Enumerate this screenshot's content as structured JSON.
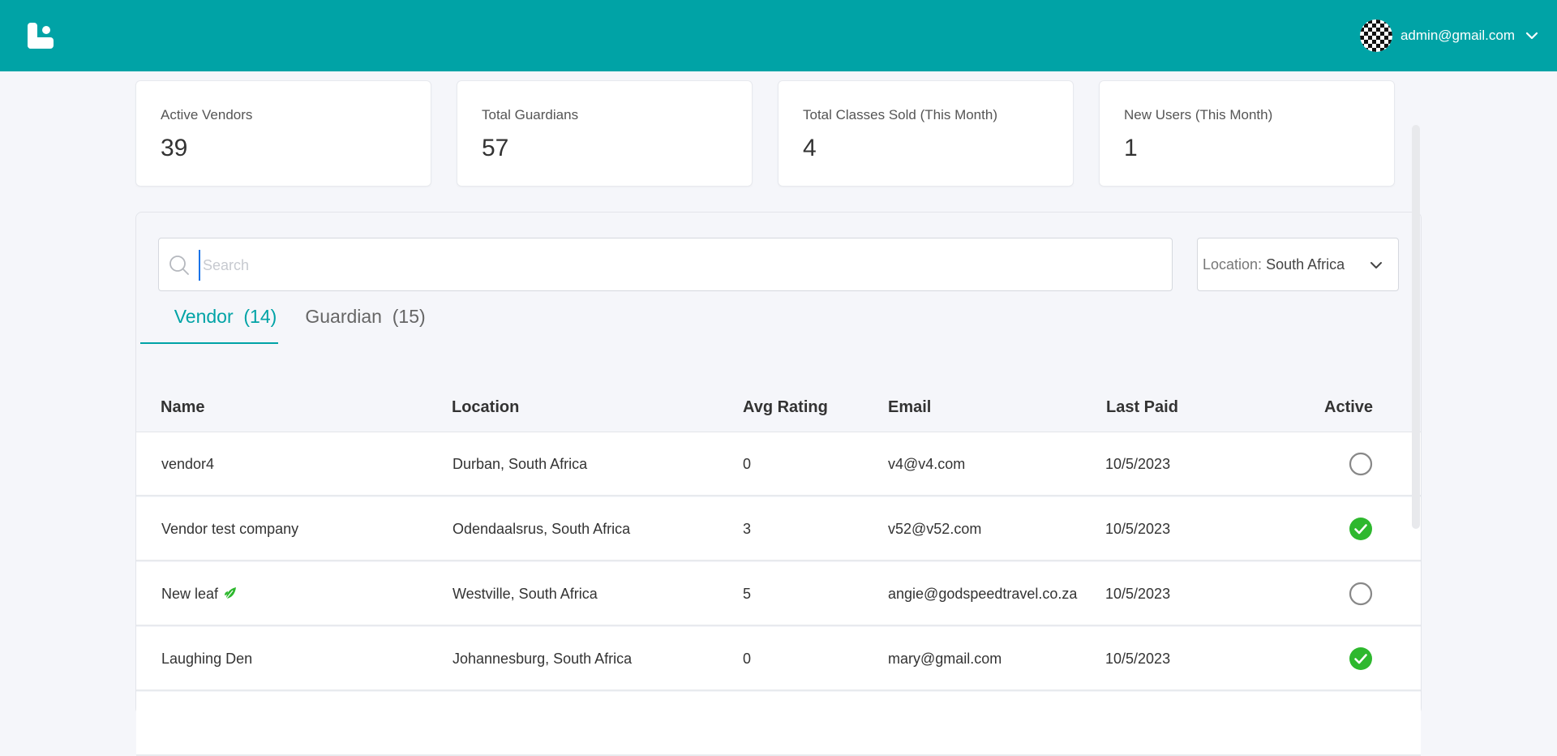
{
  "header": {
    "user_email": "admin@gmail.com"
  },
  "stats": [
    {
      "label": "Active Vendors",
      "value": "39"
    },
    {
      "label": "Total Guardians",
      "value": "57"
    },
    {
      "label": "Total Classes Sold (This Month)",
      "value": "4"
    },
    {
      "label": "New Users (This Month)",
      "value": "1"
    }
  ],
  "search": {
    "placeholder": "Search",
    "value": ""
  },
  "location_filter": {
    "prefix": "Location:",
    "value": "South Africa"
  },
  "tabs": [
    {
      "label": "Vendor  (14)",
      "active": true
    },
    {
      "label": "Guardian  (15)",
      "active": false
    }
  ],
  "table": {
    "columns": [
      "Name",
      "Location",
      "Avg Rating",
      "Email",
      "Last Paid",
      "Active"
    ],
    "rows": [
      {
        "name": "vendor4",
        "location": "Durban, South Africa",
        "rating": "0",
        "email": "v4@v4.com",
        "last_paid": "10/5/2023",
        "active": false
      },
      {
        "name": "Vendor test company",
        "location": "Odendaalsrus, South Africa",
        "rating": "3",
        "email": "v52@v52.com",
        "last_paid": "10/5/2023",
        "active": true
      },
      {
        "name": "New leaf",
        "location": "Westville, South Africa",
        "rating": "5",
        "email": "angie@godspeedtravel.co.za",
        "last_paid": "10/5/2023",
        "active": false,
        "icon": "leaf-icon"
      },
      {
        "name": "Laughing Den",
        "location": "Johannesburg, South Africa",
        "rating": "0",
        "email": "mary@gmail.com",
        "last_paid": "10/5/2023",
        "active": true
      }
    ]
  },
  "colors": {
    "brand": "#00a3a6",
    "active_green": "#2eb82e",
    "inactive_grey": "#888888"
  }
}
